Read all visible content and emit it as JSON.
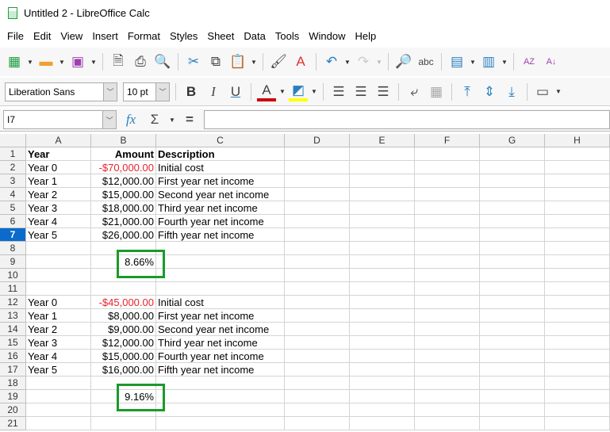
{
  "window": {
    "title": "Untitled 2 - LibreOffice Calc"
  },
  "menu": [
    "File",
    "Edit",
    "View",
    "Insert",
    "Format",
    "Styles",
    "Sheet",
    "Data",
    "Tools",
    "Window",
    "Help"
  ],
  "format": {
    "font_name": "Liberation Sans",
    "font_size": "10 pt"
  },
  "formula_bar": {
    "cell_ref": "I7",
    "value": ""
  },
  "columns": [
    "A",
    "B",
    "C",
    "D",
    "E",
    "F",
    "G",
    "H"
  ],
  "selected_row": 7,
  "rows": [
    [
      "Year",
      "Amount",
      "Description"
    ],
    [
      "Year 0",
      "-$70,000.00",
      "Initial cost"
    ],
    [
      "Year 1",
      "$12,000.00",
      "First year net income"
    ],
    [
      "Year 2",
      "$15,000.00",
      "Second year net income"
    ],
    [
      "Year 3",
      "$18,000.00",
      "Third year net income"
    ],
    [
      "Year 4",
      "$21,000.00",
      "Fourth year net income"
    ],
    [
      "Year 5",
      "$26,000.00",
      "Fifth year net income"
    ],
    [
      "",
      "",
      ""
    ],
    [
      "",
      "8.66%",
      ""
    ],
    [
      "",
      "",
      ""
    ],
    [
      "",
      "",
      ""
    ],
    [
      "Year 0",
      "-$45,000.00",
      "Initial cost"
    ],
    [
      "Year 1",
      "$8,000.00",
      "First year net income"
    ],
    [
      "Year 2",
      "$9,000.00",
      "Second year net income"
    ],
    [
      "Year 3",
      "$12,000.00",
      "Third year net income"
    ],
    [
      "Year 4",
      "$15,000.00",
      "Fourth year net income"
    ],
    [
      "Year 5",
      "$16,000.00",
      "Fifth year net income"
    ],
    [
      "",
      "",
      ""
    ],
    [
      "",
      "9.16%",
      ""
    ],
    [
      "",
      "",
      ""
    ],
    [
      "",
      "",
      ""
    ]
  ],
  "colors": {
    "highlight": "#1a9a2a",
    "negative": "#e8232b",
    "selection": "#0b6bcd"
  }
}
